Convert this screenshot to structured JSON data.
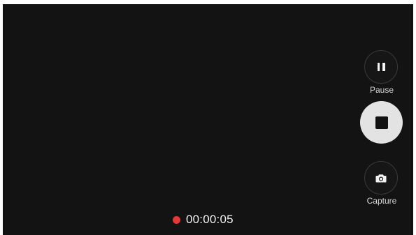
{
  "controls": {
    "pause_label": "Pause",
    "capture_label": "Capture"
  },
  "recording": {
    "elapsed": "00:00:05",
    "indicator_color": "#e53935"
  },
  "icons": {
    "pause": "pause-icon",
    "stop": "stop-icon",
    "capture": "camera-icon",
    "recording": "record-dot-icon"
  }
}
